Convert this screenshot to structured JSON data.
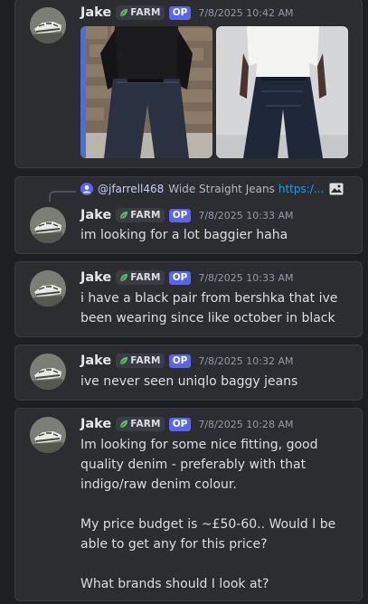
{
  "colors": {
    "background": "#1e1f22",
    "card": "#2b2d31",
    "op_badge": "#5865f2",
    "link": "#00a8fc",
    "timestamp": "#949ba4"
  },
  "author": {
    "name": "Jake",
    "tag_icon": "leaf-icon",
    "tag": "FARM",
    "op_badge": "OP"
  },
  "messages": [
    {
      "timestamp": "7/8/2025 10:42 AM",
      "text": "",
      "attachments": [
        {
          "kind": "image",
          "subject": "person in black hoodie and wide dark jeans against brick wall"
        },
        {
          "kind": "image",
          "subject": "person in white t-shirt and wide dark jeans"
        }
      ]
    },
    {
      "reply": {
        "avatar_icon": "user-avatar-icon",
        "mention": "@jfarrell468",
        "title": "Wide Straight Jeans",
        "link": "https:/...",
        "attachment_icon": "image-icon"
      },
      "timestamp": "7/8/2025 10:33 AM",
      "text": "im looking for a lot baggier haha"
    },
    {
      "timestamp": "7/8/2025 10:33 AM",
      "text": "i have a black pair from bershka that ive been wearing since like october in black"
    },
    {
      "timestamp": "7/8/2025 10:32 AM",
      "text": "ive never seen uniqlo baggy jeans"
    },
    {
      "timestamp": "7/8/2025 10:28 AM",
      "text": "Im looking for some nice fitting, good quality denim - preferably with that indigo/raw denim colour.\n\nMy price budget is ~£50-60.. Would I be able to get any for this price?\n\nWhat brands should I look at?"
    }
  ]
}
